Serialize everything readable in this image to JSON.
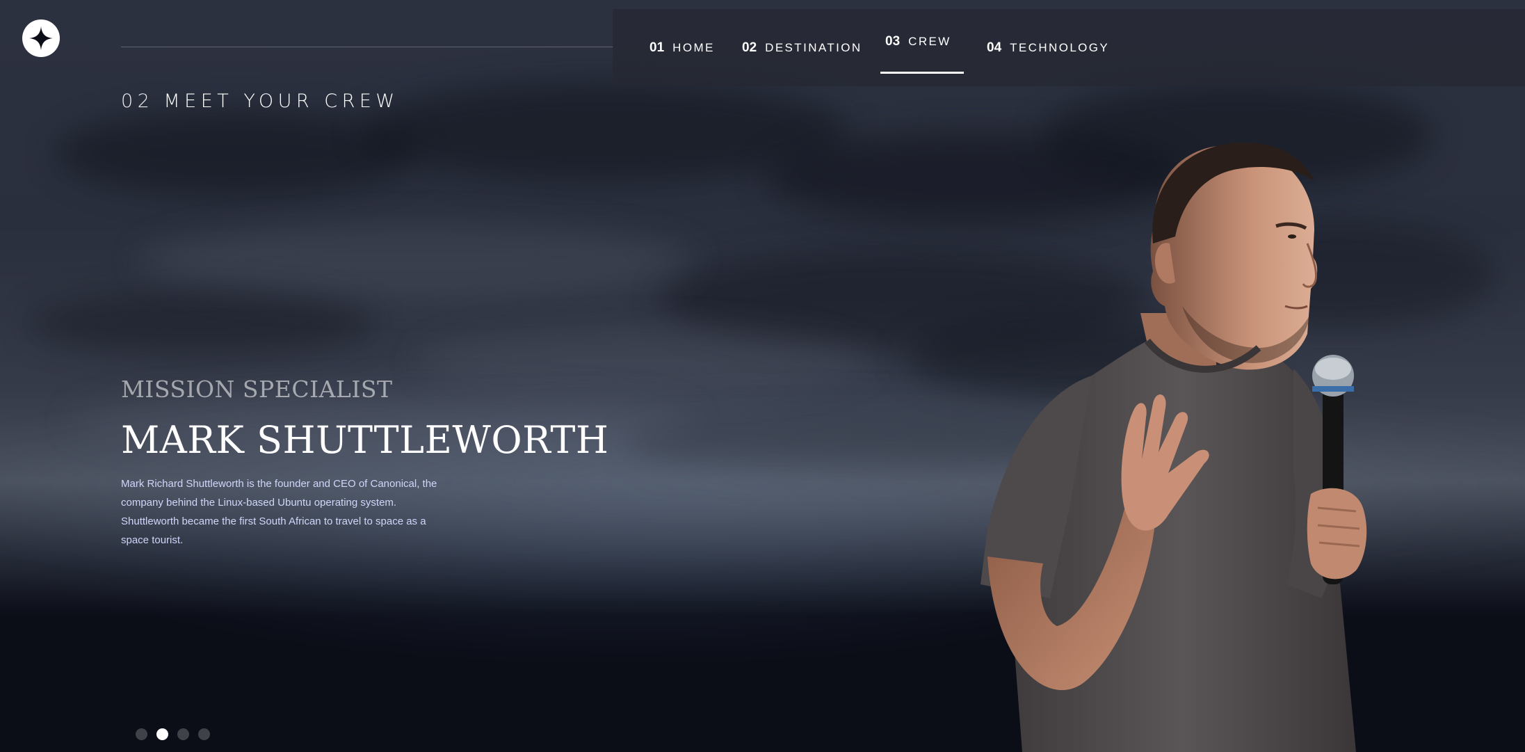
{
  "nav": {
    "items": [
      {
        "num": "01",
        "label": "HOME",
        "active": false
      },
      {
        "num": "02",
        "label": "DESTINATION",
        "active": false
      },
      {
        "num": "03",
        "label": "CREW",
        "active": true
      },
      {
        "num": "04",
        "label": "TECHNOLOGY",
        "active": false
      }
    ]
  },
  "page_title": {
    "num": "02",
    "text": "MEET YOUR CREW"
  },
  "crew": {
    "role": "MISSION SPECIALIST",
    "name": "MARK SHUTTLEWORTH",
    "bio": "Mark Richard Shuttleworth is the founder and CEO of Canonical, the company behind the Linux-based Ubuntu operating system. Shuttleworth became the first South African to travel to space as a space tourist.",
    "image_icon": "crew-portrait-image"
  },
  "pagination": {
    "count": 4,
    "active_index": 1
  },
  "colors": {
    "background": "#0b0d17",
    "text_muted": "#d0d6f9",
    "accent": "#ffffff"
  },
  "icons": {
    "logo": "star-logo-icon"
  }
}
